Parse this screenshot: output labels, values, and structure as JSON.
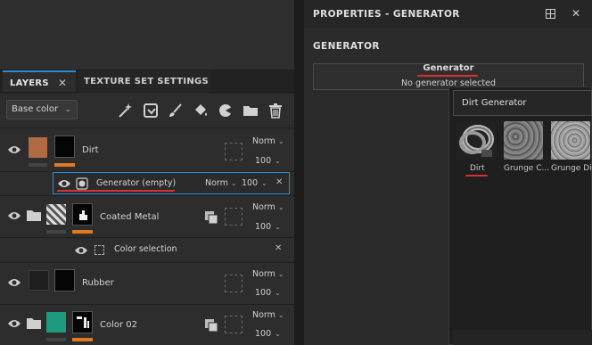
{
  "layers_panel": {
    "tabs": {
      "layers": "LAYERS",
      "texture_set_settings": "TEXTURE SET SETTINGS"
    },
    "channel": "Base color",
    "toolbar_icons": [
      "magic-wand-icon",
      "generator-fill-icon",
      "paint-brush-icon",
      "paint-bucket-icon",
      "filter-icon",
      "folder-icon",
      "trash-icon"
    ],
    "layers": [
      {
        "name": "Dirt",
        "blend": "Norm",
        "opacity": "100",
        "color": "#b06a46",
        "bar_color": "#e07a20"
      },
      {
        "name": "Generator (empty)",
        "blend": "Norm",
        "opacity": "100"
      },
      {
        "name": "Coated Metal",
        "blend": "Norm",
        "opacity": "100",
        "bar_color": "#e07a20"
      },
      {
        "name": "Color selection"
      },
      {
        "name": "Rubber",
        "blend": "Norm",
        "opacity": "100"
      },
      {
        "name": "Color 02",
        "blend": "Norm",
        "opacity": "100",
        "color": "#1e9a80",
        "bar_color": "#e07a20"
      }
    ]
  },
  "properties_panel": {
    "title": "PROPERTIES - GENERATOR",
    "section_heading": "GENERATOR",
    "generator_label": "Generator",
    "generator_status": "No generator selected",
    "popup": {
      "search_value": "Dirt Generator",
      "items": [
        {
          "label": "Dirt"
        },
        {
          "label": "Grunge C..."
        },
        {
          "label": "Grunge Dirt"
        }
      ]
    }
  },
  "colors": {
    "accent_blue": "#2e8bd6",
    "highlight_orange": "#e07a20",
    "annotation_red": "#d93030"
  }
}
